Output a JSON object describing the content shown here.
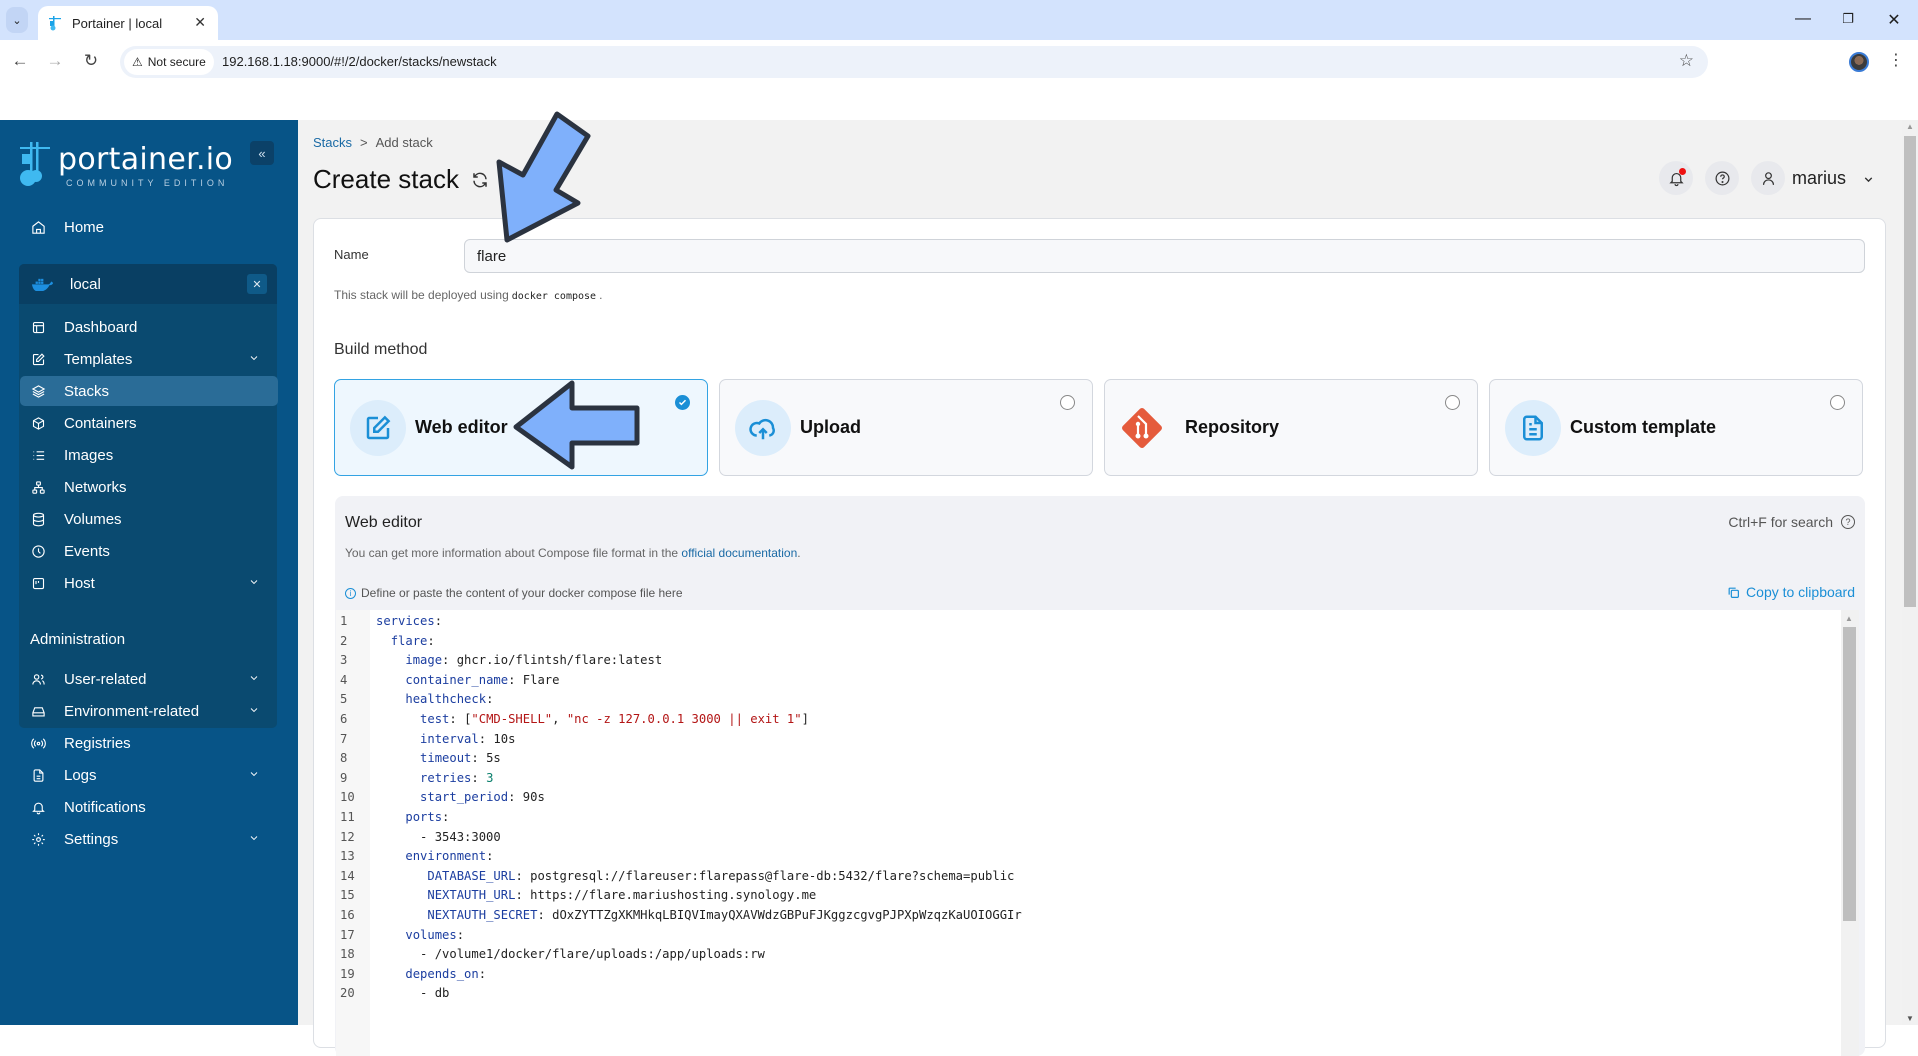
{
  "browser": {
    "tab_title": "Portainer | local",
    "security_label": "Not secure",
    "url": "192.168.1.18:9000/#!/2/docker/stacks/newstack"
  },
  "sidebar": {
    "logo_text": "portainer.io",
    "logo_subtitle": "COMMUNITY EDITION",
    "home_label": "Home",
    "environment": {
      "name": "local",
      "items": [
        {
          "label": "Dashboard",
          "icon": "dashboard-icon",
          "expandable": false
        },
        {
          "label": "Templates",
          "icon": "edit-icon",
          "expandable": true
        },
        {
          "label": "Stacks",
          "icon": "layers-icon",
          "expandable": false,
          "active": true
        },
        {
          "label": "Containers",
          "icon": "box-icon",
          "expandable": false
        },
        {
          "label": "Images",
          "icon": "list-icon",
          "expandable": false
        },
        {
          "label": "Networks",
          "icon": "network-icon",
          "expandable": false
        },
        {
          "label": "Volumes",
          "icon": "database-icon",
          "expandable": false
        },
        {
          "label": "Events",
          "icon": "clock-icon",
          "expandable": false
        },
        {
          "label": "Host",
          "icon": "host-icon",
          "expandable": true
        }
      ]
    },
    "admin_title": "Administration",
    "admin_items": [
      {
        "label": "User-related",
        "icon": "users-icon",
        "expandable": true
      },
      {
        "label": "Environment-related",
        "icon": "hard-drive-icon",
        "expandable": true
      },
      {
        "label": "Registries",
        "icon": "radio-icon",
        "expandable": false
      },
      {
        "label": "Logs",
        "icon": "file-text-icon",
        "expandable": true
      },
      {
        "label": "Notifications",
        "icon": "bell-icon",
        "expandable": false
      },
      {
        "label": "Settings",
        "icon": "gear-icon",
        "expandable": true
      }
    ]
  },
  "header": {
    "breadcrumb": {
      "parent": "Stacks",
      "separator": ">",
      "current": "Add stack"
    },
    "title": "Create stack",
    "username": "marius"
  },
  "form": {
    "name_label": "Name",
    "name_value": "flare",
    "deploy_note_prefix": "This stack will be deployed using",
    "deploy_note_code": "docker compose",
    "deploy_note_suffix": ".",
    "build_method_label": "Build method",
    "build_methods": [
      {
        "label": "Web editor",
        "selected": true
      },
      {
        "label": "Upload",
        "selected": false
      },
      {
        "label": "Repository",
        "selected": false
      },
      {
        "label": "Custom template",
        "selected": false
      }
    ]
  },
  "editor": {
    "title": "Web editor",
    "search_hint": "Ctrl+F for search",
    "info_prefix": "You can get more information about Compose file format in the",
    "info_link": "official documentation",
    "info_suffix": ".",
    "define_hint": "Define or paste the content of your docker compose file here",
    "copy_label": "Copy to clipboard",
    "lines": [
      {
        "n": "1",
        "indent": "",
        "key": "services",
        "sep": ":",
        "value": "",
        "vtype": ""
      },
      {
        "n": "2",
        "indent": "  ",
        "key": "flare",
        "sep": ":",
        "value": "",
        "vtype": ""
      },
      {
        "n": "3",
        "indent": "    ",
        "key": "image",
        "sep": ": ",
        "value": "ghcr.io/flintsh/flare:latest",
        "vtype": ""
      },
      {
        "n": "4",
        "indent": "    ",
        "key": "container_name",
        "sep": ": ",
        "value": "Flare",
        "vtype": ""
      },
      {
        "n": "5",
        "indent": "    ",
        "key": "healthcheck",
        "sep": ":",
        "value": "",
        "vtype": ""
      },
      {
        "n": "6",
        "indent": "      ",
        "key": "test",
        "sep": ": ",
        "value": "[\"CMD-SHELL\", \"nc -z 127.0.0.1 3000 || exit 1\"]",
        "vtype": "array"
      },
      {
        "n": "7",
        "indent": "      ",
        "key": "interval",
        "sep": ": ",
        "value": "10s",
        "vtype": ""
      },
      {
        "n": "8",
        "indent": "      ",
        "key": "timeout",
        "sep": ": ",
        "value": "5s",
        "vtype": ""
      },
      {
        "n": "9",
        "indent": "      ",
        "key": "retries",
        "sep": ": ",
        "value": "3",
        "vtype": "number"
      },
      {
        "n": "10",
        "indent": "      ",
        "key": "start_period",
        "sep": ": ",
        "value": "90s",
        "vtype": ""
      },
      {
        "n": "11",
        "indent": "    ",
        "key": "ports",
        "sep": ":",
        "value": "",
        "vtype": ""
      },
      {
        "n": "12",
        "indent": "      ",
        "key": "",
        "sep": "",
        "value": "- 3543:3000",
        "vtype": ""
      },
      {
        "n": "13",
        "indent": "    ",
        "key": "environment",
        "sep": ":",
        "value": "",
        "vtype": ""
      },
      {
        "n": "14",
        "indent": "       ",
        "key": "DATABASE_URL",
        "sep": ": ",
        "value": "postgresql://flareuser:flarepass@flare-db:5432/flare?schema=public",
        "vtype": ""
      },
      {
        "n": "15",
        "indent": "       ",
        "key": "NEXTAUTH_URL",
        "sep": ": ",
        "value": "https://flare.mariushosting.synology.me",
        "vtype": ""
      },
      {
        "n": "16",
        "indent": "       ",
        "key": "NEXTAUTH_SECRET",
        "sep": ": ",
        "value": "dOxZYTTZgXKMHkqLBIQVImayQXAVWdzGBPuFJKggzcgvgPJPXpWzqzKaUOIOGGIr",
        "vtype": ""
      },
      {
        "n": "17",
        "indent": "    ",
        "key": "volumes",
        "sep": ":",
        "value": "",
        "vtype": ""
      },
      {
        "n": "18",
        "indent": "      ",
        "key": "",
        "sep": "",
        "value": "- /volume1/docker/flare/uploads:/app/uploads:rw",
        "vtype": ""
      },
      {
        "n": "19",
        "indent": "    ",
        "key": "depends_on",
        "sep": ":",
        "value": "",
        "vtype": ""
      },
      {
        "n": "20",
        "indent": "      ",
        "key": "",
        "sep": "",
        "value": "- db",
        "vtype": ""
      }
    ]
  },
  "colors": {
    "sidebar_bg": "#075487",
    "accent": "#1b8fd6",
    "yaml_key": "#1c3ea0",
    "yaml_string": "#b31515",
    "annotation_arrow": "#7fb0fb"
  }
}
